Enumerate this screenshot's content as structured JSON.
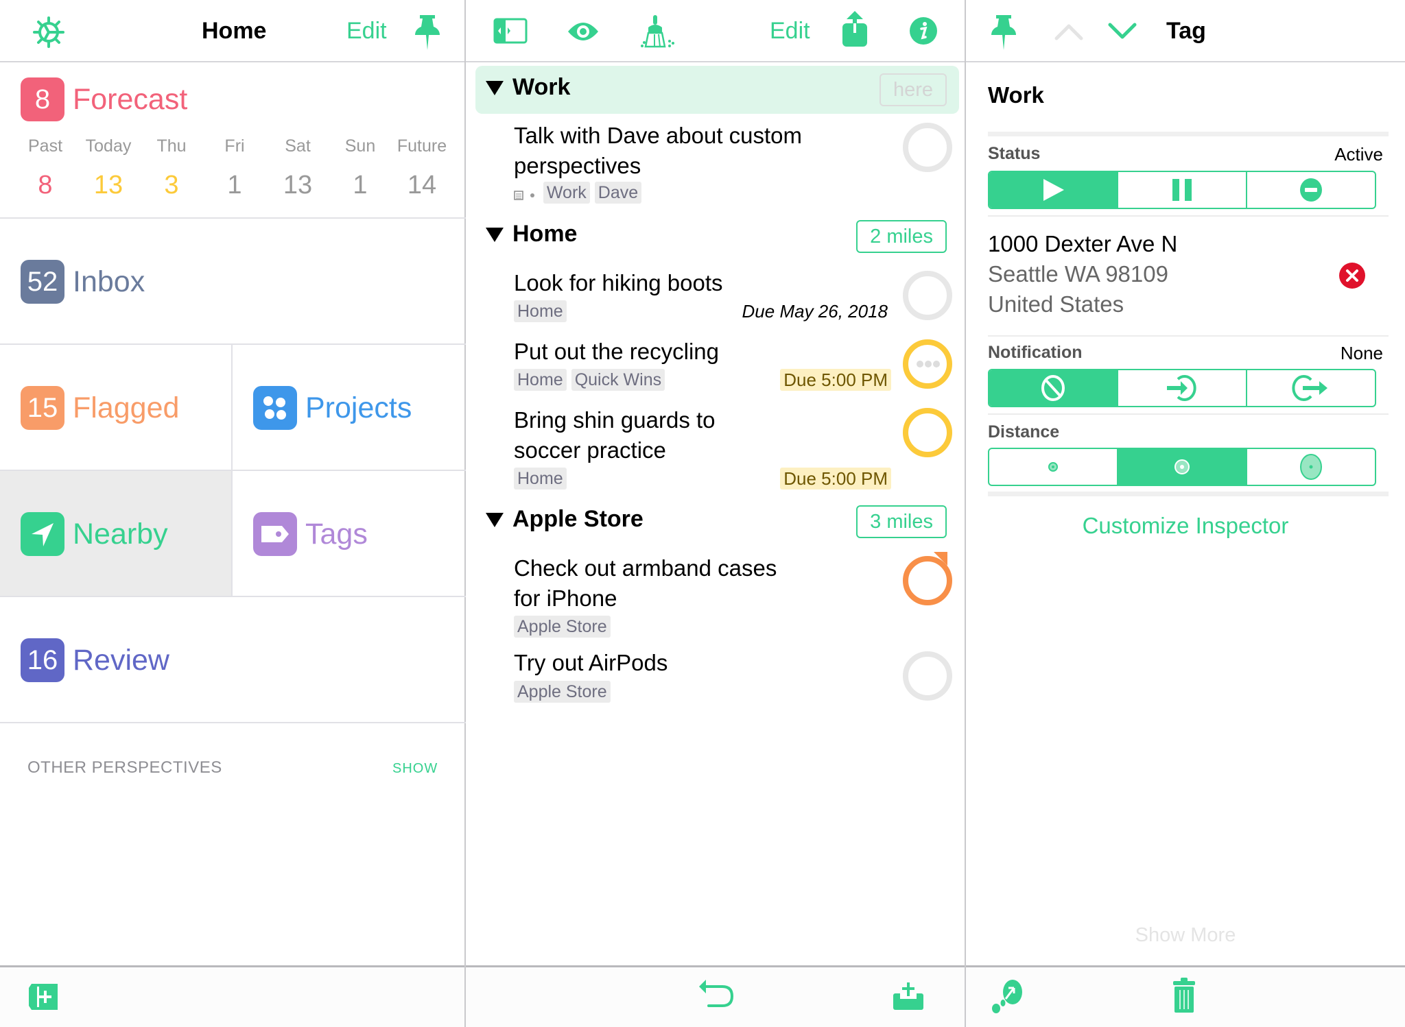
{
  "sidebar": {
    "title": "Home",
    "edit_label": "Edit",
    "forecast": {
      "badge": "8",
      "label": "Forecast",
      "color": "#f2627a",
      "columns": [
        {
          "day": "Past",
          "count": "8",
          "color": "#f2627a"
        },
        {
          "day": "Today",
          "count": "13",
          "color": "#fcca3a"
        },
        {
          "day": "Thu",
          "count": "3",
          "color": "#fcca3a"
        },
        {
          "day": "Fri",
          "count": "1",
          "color": "#999999"
        },
        {
          "day": "Sat",
          "count": "13",
          "color": "#999999"
        },
        {
          "day": "Sun",
          "count": "1",
          "color": "#999999"
        },
        {
          "day": "Future",
          "count": "14",
          "color": "#999999"
        }
      ]
    },
    "inbox": {
      "badge": "52",
      "label": "Inbox",
      "color": "#6a7b9c"
    },
    "flagged": {
      "badge": "15",
      "label": "Flagged",
      "color": "#f89c68"
    },
    "projects": {
      "label": "Projects",
      "color": "#3e97ea"
    },
    "nearby": {
      "label": "Nearby",
      "color": "#36d18f",
      "selected": true
    },
    "tags": {
      "label": "Tags",
      "color": "#b088d8"
    },
    "review": {
      "badge": "16",
      "label": "Review",
      "color": "#6067c6"
    },
    "other_perspectives": {
      "label": "OTHER PERSPECTIVES",
      "action": "SHOW"
    }
  },
  "main": {
    "edit_label": "Edit",
    "groups": [
      {
        "name": "Work",
        "distance": "here",
        "highlighted": true,
        "tasks": [
          {
            "title_lines": [
              "Talk with Dave about custom",
              "perspectives"
            ],
            "tags": [
              "Work",
              "Dave"
            ],
            "has_note": true,
            "due": "",
            "status": "none"
          }
        ]
      },
      {
        "name": "Home",
        "distance": "2 miles",
        "tasks": [
          {
            "title_lines": [
              "Look for hiking boots"
            ],
            "tags": [
              "Home"
            ],
            "due": "Due May 26, 2018",
            "status": "none"
          },
          {
            "title_lines": [
              "Put out the recycling"
            ],
            "tags": [
              "Home",
              "Quick Wins"
            ],
            "due": "Due 5:00 PM",
            "status": "due-soon-repeat"
          },
          {
            "title_lines": [
              "Bring shin guards to",
              "soccer practice"
            ],
            "tags": [
              "Home"
            ],
            "due": "Due 5:00 PM",
            "status": "due-soon"
          }
        ]
      },
      {
        "name": "Apple Store",
        "distance": "3 miles",
        "tasks": [
          {
            "title_lines": [
              "Check out armband cases",
              "for iPhone"
            ],
            "tags": [
              "Apple Store"
            ],
            "due": "",
            "status": "flagged"
          },
          {
            "title_lines": [
              "Try out AirPods"
            ],
            "tags": [
              "Apple Store"
            ],
            "due": "",
            "status": "none"
          }
        ]
      }
    ]
  },
  "inspector": {
    "title": "Tag",
    "tag_name": "Work",
    "status": {
      "label": "Status",
      "value": "Active",
      "options": [
        "active",
        "on-hold",
        "dropped"
      ],
      "selected": 0
    },
    "address": {
      "line1": "1000 Dexter Ave N",
      "line2": "Seattle WA 98109",
      "line3": "United States"
    },
    "notification": {
      "label": "Notification",
      "value": "None",
      "options": [
        "none",
        "arriving",
        "leaving"
      ],
      "selected": 0
    },
    "distance": {
      "label": "Distance",
      "options": [
        "small",
        "medium",
        "large"
      ],
      "selected": 1
    },
    "customize_label": "Customize Inspector",
    "show_more_label": "Show More"
  },
  "colors": {
    "accent": "#36d18f",
    "remove": "#e0112b"
  }
}
